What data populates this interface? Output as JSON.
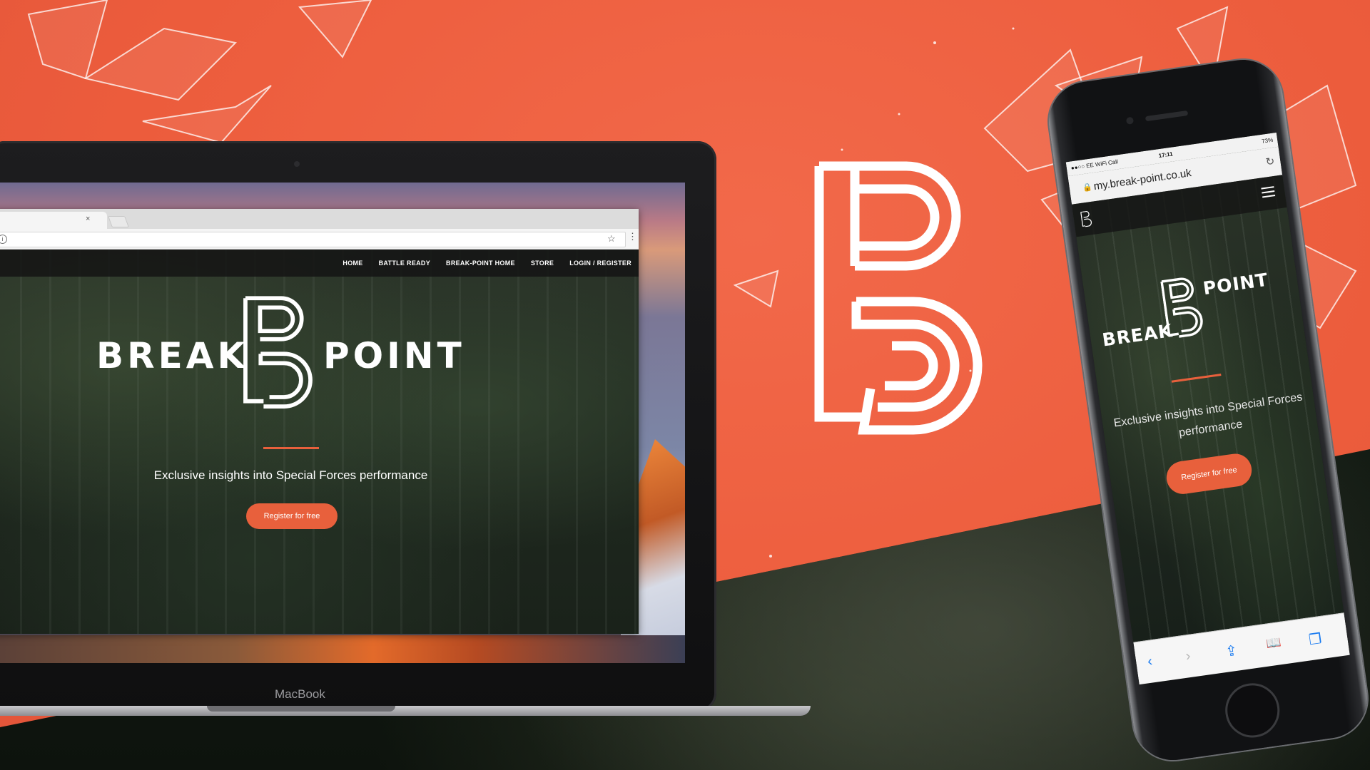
{
  "colors": {
    "brand_orange": "#ec5c3c",
    "button_orange": "#e8603c"
  },
  "laptop": {
    "brand_label": "MacBook",
    "browser": {
      "tab_close": "×",
      "info_icon": "i",
      "star_icon": "☆",
      "menu_icon": "⋮"
    },
    "site": {
      "nav": [
        "HOME",
        "BATTLE READY",
        "BREAK-POINT HOME",
        "STORE",
        "LOGIN / REGISTER"
      ],
      "logo_left": "BREAK",
      "logo_right": "POINT",
      "tagline": "Exclusive insights into Special Forces performance",
      "cta": "Register for free"
    }
  },
  "phone": {
    "status": {
      "carrier": "●●○○ EE WiFi Call",
      "time": "17:11",
      "battery": "73%"
    },
    "url": "my.break-point.co.uk",
    "logo_left": "BREAK",
    "logo_right": "POINT",
    "tagline": "Exclusive insights into Special Forces performance",
    "cta": "Register for free",
    "toolbar": {
      "back": "‹",
      "forward": "›",
      "share": "⇪",
      "bookmarks": "📖",
      "tabs": "❐"
    }
  }
}
